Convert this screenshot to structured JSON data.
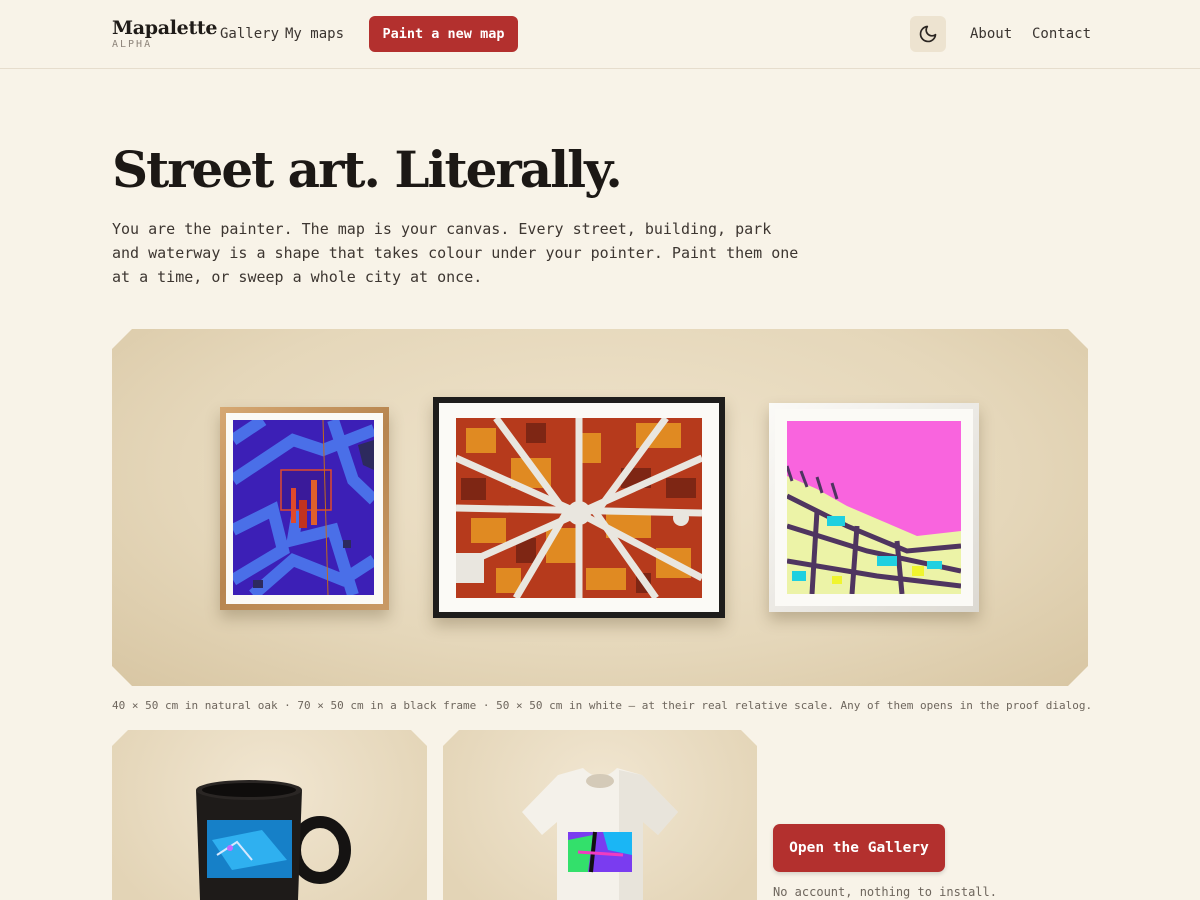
{
  "header": {
    "brand": "Mapalette",
    "brand_tag": "ALPHA",
    "nav": {
      "gallery": "Gallery",
      "my_maps": "My maps",
      "about": "About",
      "contact": "Contact"
    },
    "cta": "Paint a new map",
    "theme_icon": "moon-icon"
  },
  "hero": {
    "title": "Street art. Literally.",
    "description": "You are the painter. The map is your canvas. Every street, building, park and waterway is a shape that takes colour under your pointer. Paint them one at a time, or sweep a whole city at once."
  },
  "showcase": {
    "caption": "40 × 50 cm in natural oak · 70 × 50 cm in a black frame · 50 × 50 cm in white — at their real relative scale. Any of them opens in the proof dialog."
  },
  "products": {
    "gallery_button": "Open the Gallery",
    "note": "No account, nothing to install."
  },
  "colors": {
    "accent": "#b3302e",
    "background": "#f8f3e8"
  }
}
